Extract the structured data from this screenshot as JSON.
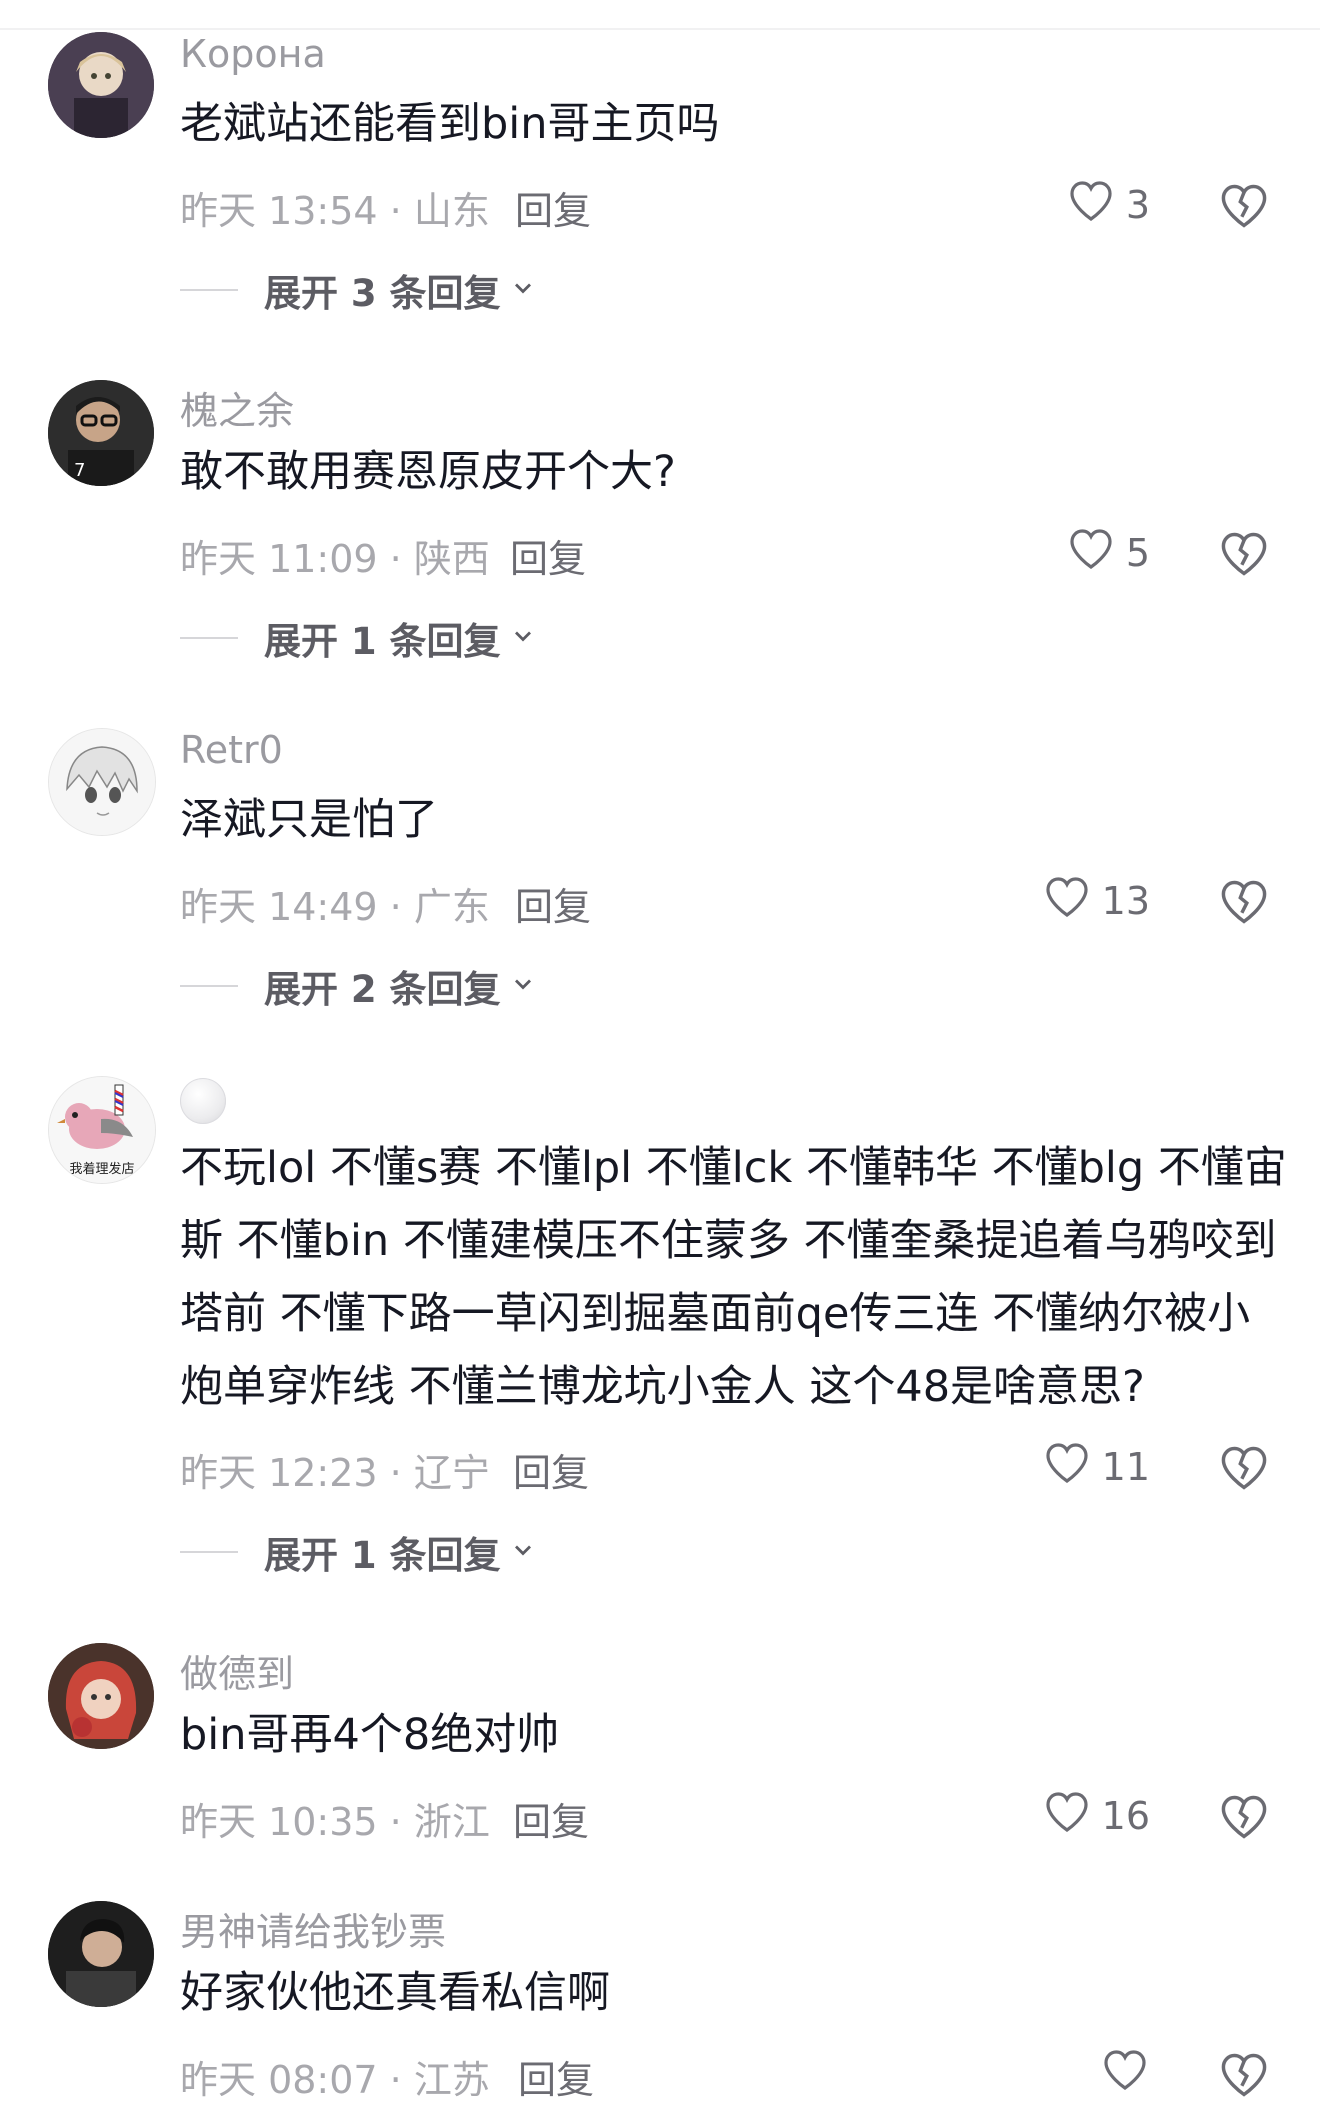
{
  "comments": [
    {
      "username": "Корона",
      "text": "老斌站还能看到bin哥主页吗",
      "time": "昨天 13:54 · 山东",
      "reply_label": "回复",
      "likes": "3",
      "expand_label": "展开 3 条回复"
    },
    {
      "username": "槐之余",
      "text": "敢不敢用赛恩原皮开个大?",
      "time": "昨天 11:09 · 陕西",
      "reply_label": "回复",
      "likes": "5",
      "expand_label": "展开 1 条回复"
    },
    {
      "username": "Retr0",
      "text": "泽斌只是怕了",
      "time": "昨天 14:49 · 广东",
      "reply_label": "回复",
      "likes": "13",
      "expand_label": "展开 2 条回复"
    },
    {
      "username": "",
      "text": "不玩lol 不懂s赛 不懂lpl 不懂lck 不懂韩华 不懂blg 不懂宙斯 不懂bin 不懂建模压不住蒙多 不懂奎桑提追着乌鸦咬到塔前 不懂下路一草闪到掘墓面前qe传三连 不懂纳尔被小炮单穿炸线 不懂兰博龙坑小金人 这个48是啥意思?",
      "time": "昨天 12:23 · 辽宁",
      "reply_label": "回复",
      "likes": "11",
      "expand_label": "展开 1 条回复",
      "avatar_caption": "我着理发店"
    },
    {
      "username": "做德到",
      "text": "bin哥再4个8绝对帅",
      "time": "昨天 10:35 · 浙江",
      "reply_label": "回复",
      "likes": "16"
    },
    {
      "username": "男神请给我钞票",
      "text": "好家伙他还真看私信啊",
      "time": "昨天 08:07 · 江苏",
      "reply_label": "回复"
    }
  ],
  "icons": {
    "like": "heart-outline-icon",
    "dislike": "broken-heart-icon",
    "expand": "chevron-down-icon"
  },
  "colors": {
    "username": "#9a9aa0",
    "text": "#161823",
    "meta": "#a8a8ad",
    "action": "#6b6b72"
  }
}
